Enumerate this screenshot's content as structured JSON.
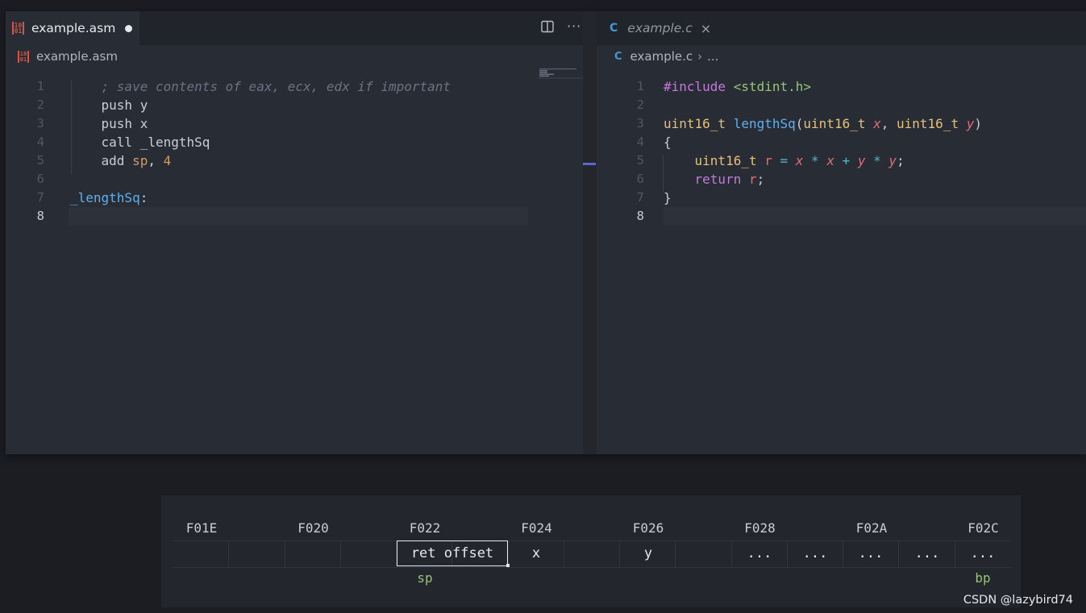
{
  "left_editor": {
    "tab_label": "example.asm",
    "tab_icon": "asm-file-icon",
    "unsaved": true,
    "breadcrumb": "example.asm",
    "lines": [
      {
        "num": "1",
        "tokens": [
          {
            "t": "    ; save contents of eax, ecx, edx if important",
            "c": "comment"
          }
        ]
      },
      {
        "num": "2",
        "tokens": [
          {
            "t": "    push y",
            "c": "plain"
          }
        ]
      },
      {
        "num": "3",
        "tokens": [
          {
            "t": "    push x",
            "c": "plain"
          }
        ]
      },
      {
        "num": "4",
        "tokens": [
          {
            "t": "    call _lengthSq",
            "c": "plain"
          }
        ]
      },
      {
        "num": "5",
        "tokens": [
          {
            "t": "    add ",
            "c": "plain"
          },
          {
            "t": "sp",
            "c": "orange"
          },
          {
            "t": ", ",
            "c": "plain"
          },
          {
            "t": "4",
            "c": "orange"
          }
        ]
      },
      {
        "num": "6",
        "tokens": []
      },
      {
        "num": "7",
        "tokens": [
          {
            "t": "_lengthSq",
            "c": "label"
          },
          {
            "t": ":",
            "c": "plain"
          }
        ]
      },
      {
        "num": "8",
        "tokens": []
      }
    ],
    "active_line": "8"
  },
  "right_editor": {
    "tab_label": "example.c",
    "tab_icon": "c-file-icon",
    "breadcrumb": "example.c",
    "breadcrumb_more": "...",
    "lines": [
      {
        "num": "1",
        "tokens": [
          {
            "t": "#include",
            "c": "kw"
          },
          {
            "t": " ",
            "c": "plain"
          },
          {
            "t": "<stdint.h>",
            "c": "str"
          }
        ]
      },
      {
        "num": "2",
        "tokens": []
      },
      {
        "num": "3",
        "tokens": [
          {
            "t": "uint16_t",
            "c": "type"
          },
          {
            "t": " ",
            "c": "plain"
          },
          {
            "t": "lengthSq",
            "c": "fn"
          },
          {
            "t": "(",
            "c": "plain"
          },
          {
            "t": "uint16_t",
            "c": "type"
          },
          {
            "t": " ",
            "c": "plain"
          },
          {
            "t": "x",
            "c": "param"
          },
          {
            "t": ", ",
            "c": "plain"
          },
          {
            "t": "uint16_t",
            "c": "type"
          },
          {
            "t": " ",
            "c": "plain"
          },
          {
            "t": "y",
            "c": "param"
          },
          {
            "t": ")",
            "c": "plain"
          }
        ]
      },
      {
        "num": "4",
        "tokens": [
          {
            "t": "{",
            "c": "plain"
          }
        ]
      },
      {
        "num": "5",
        "tokens": [
          {
            "t": "    uint16_t",
            "c": "type"
          },
          {
            "t": " ",
            "c": "plain"
          },
          {
            "t": "r",
            "c": "var"
          },
          {
            "t": " = ",
            "c": "op"
          },
          {
            "t": "x",
            "c": "param"
          },
          {
            "t": " * ",
            "c": "op"
          },
          {
            "t": "x",
            "c": "param"
          },
          {
            "t": " + ",
            "c": "op"
          },
          {
            "t": "y",
            "c": "param"
          },
          {
            "t": " * ",
            "c": "op"
          },
          {
            "t": "y",
            "c": "param"
          },
          {
            "t": ";",
            "c": "plain"
          }
        ]
      },
      {
        "num": "6",
        "tokens": [
          {
            "t": "    return",
            "c": "kw"
          },
          {
            "t": " ",
            "c": "plain"
          },
          {
            "t": "r",
            "c": "var"
          },
          {
            "t": ";",
            "c": "plain"
          }
        ]
      },
      {
        "num": "7",
        "tokens": [
          {
            "t": "}",
            "c": "plain"
          }
        ]
      },
      {
        "num": "8",
        "tokens": []
      }
    ],
    "active_line": "8"
  },
  "memory": {
    "addresses": [
      "F01E",
      "F020",
      "F022",
      "F024",
      "F026",
      "F028",
      "F02A",
      "F02C"
    ],
    "ret_label": "ret offset",
    "cells": [
      {
        "label": "x"
      },
      {
        "label": "y"
      },
      {
        "label": "..."
      },
      {
        "label": "..."
      },
      {
        "label": "..."
      },
      {
        "label": "..."
      },
      {
        "label": "..."
      }
    ],
    "sp_label": "sp",
    "bp_label": "bp"
  },
  "watermark": "CSDN @lazybird74"
}
